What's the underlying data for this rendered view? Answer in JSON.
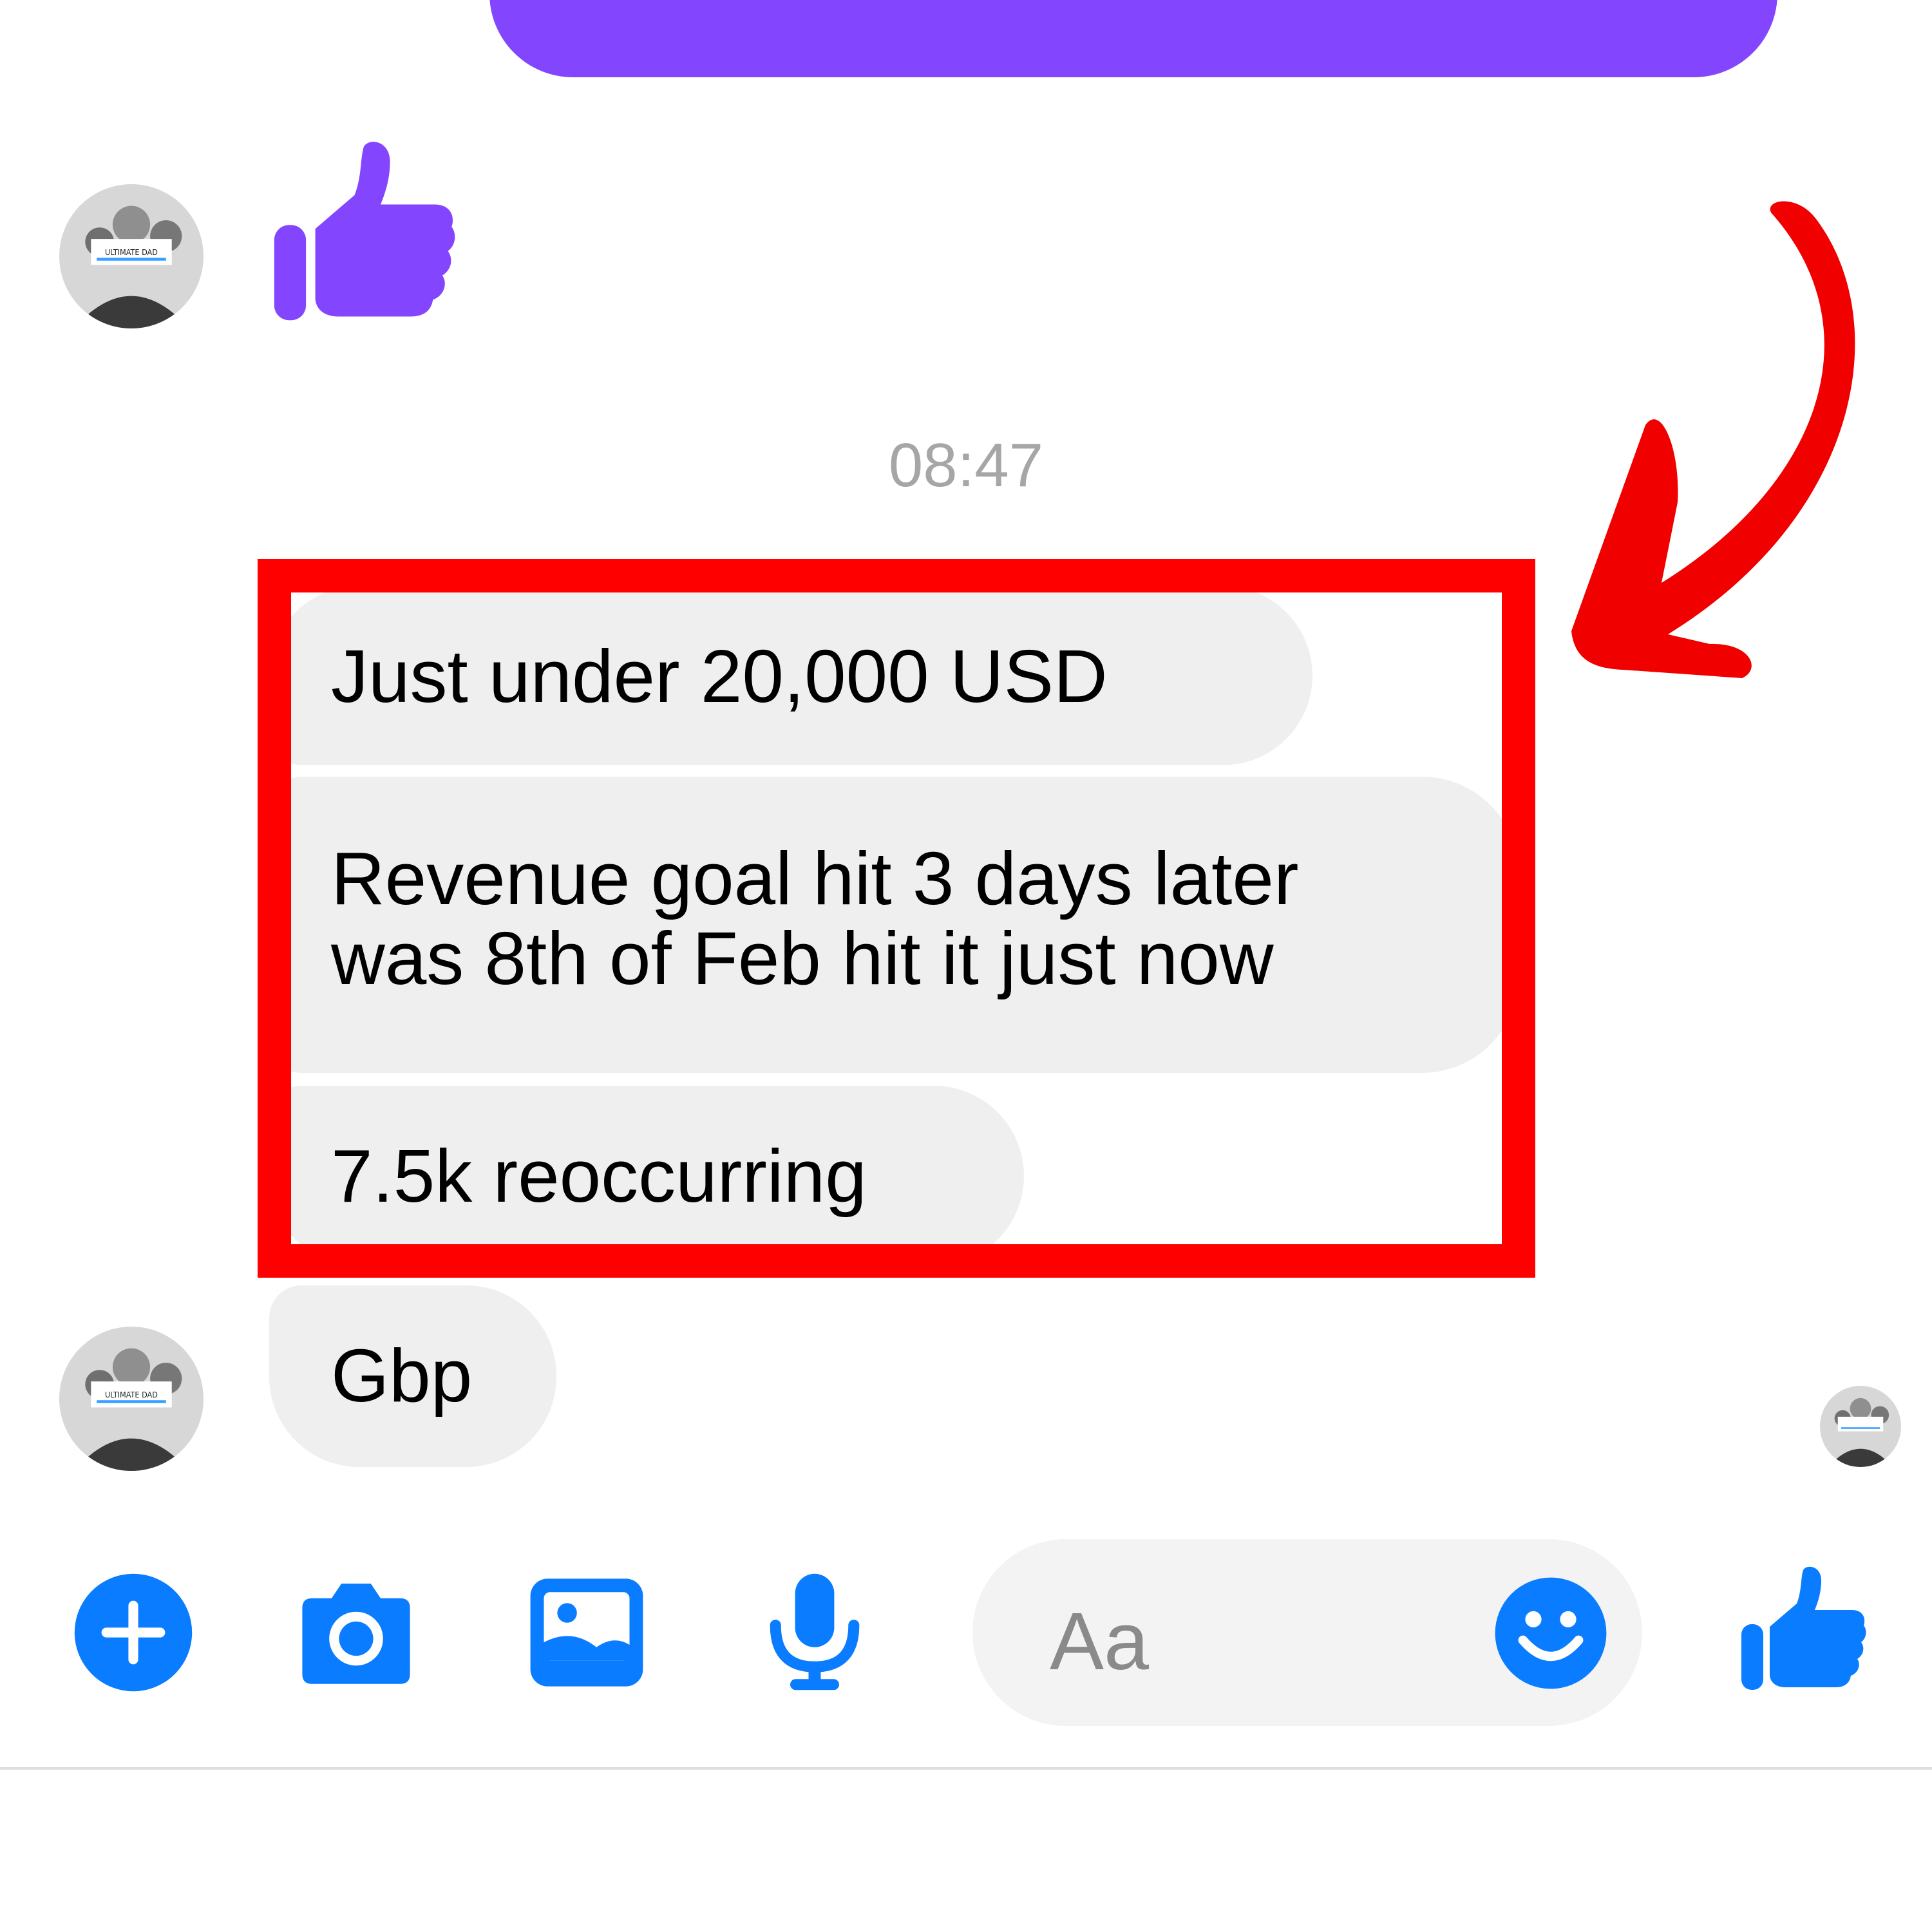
{
  "colors": {
    "sent_bubble": "#8445ff",
    "highlight": "#ff0000",
    "messenger_blue": "#0a7cff",
    "received_bubble": "#efefef",
    "timestamp": "#a6a6a6"
  },
  "conversation": {
    "timestamp": "08:47",
    "avatar_caption": "ULTIMATE DAD",
    "messages": [
      {
        "text": "Just under 20,000 USD"
      },
      {
        "line1": "Revenue goal hit 3 days later",
        "line2": "was 8th of Feb hit it just now"
      },
      {
        "text": "7.5k reoccurring"
      },
      {
        "text": "Gbp"
      }
    ]
  },
  "composer": {
    "placeholder": "Aa",
    "icons": [
      "plus-icon",
      "camera-icon",
      "gallery-icon",
      "microphone-icon",
      "emoji-icon",
      "thumbs-up-icon"
    ]
  }
}
